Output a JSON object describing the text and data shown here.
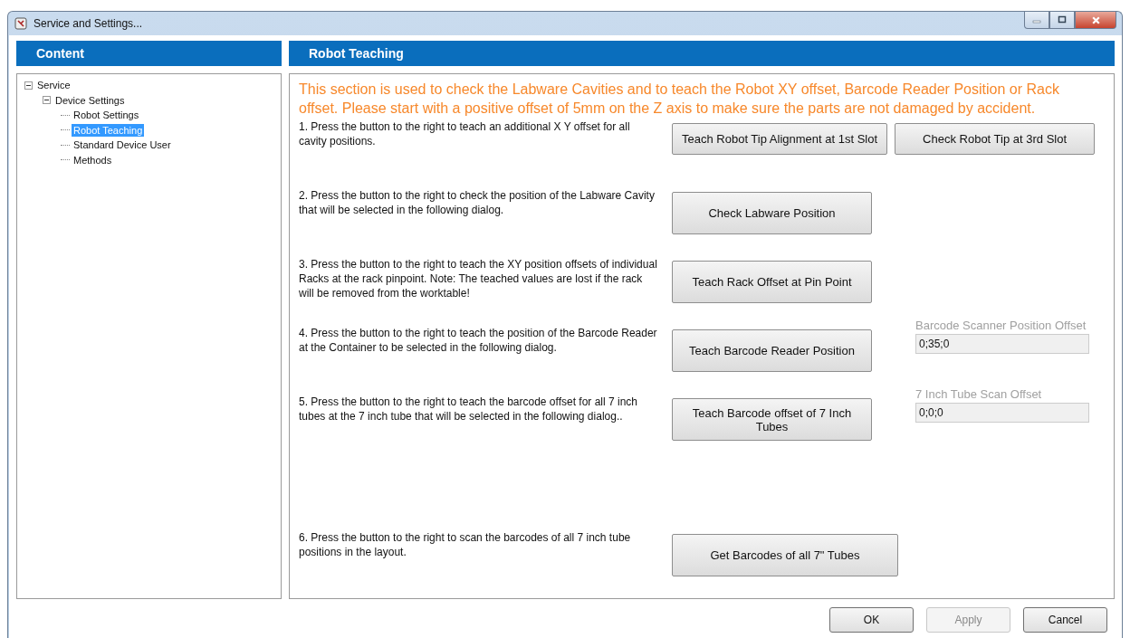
{
  "window": {
    "title": "Service and Settings..."
  },
  "sidebar": {
    "title": "Content",
    "tree": [
      {
        "label": "Service",
        "expanded": true,
        "selected": false,
        "children": [
          {
            "label": "Device Settings",
            "expanded": true,
            "selected": false,
            "children": [
              {
                "label": "Robot Settings",
                "selected": false
              },
              {
                "label": "Robot Teaching",
                "selected": true
              },
              {
                "label": "Standard Device User",
                "selected": false
              },
              {
                "label": "Methods",
                "selected": false
              }
            ]
          }
        ]
      }
    ]
  },
  "panel": {
    "title": "Robot Teaching",
    "intro": "This section is used to check the Labware Cavities and to teach the Robot XY offset, Barcode Reader Position or Rack offset. Please start with a positive offset of 5mm on the Z axis to make sure the parts are not damaged by accident.",
    "steps": [
      {
        "text": "1. Press the button to the right to teach an additional X Y offset for all cavity positions.",
        "buttons": [
          "Teach Robot Tip Alignment at 1st Slot",
          "Check Robot Tip at 3rd Slot"
        ]
      },
      {
        "text": "2. Press the button to the right to check the position of the Labware Cavity that will be selected in the following dialog.",
        "buttons": [
          "Check Labware Position"
        ]
      },
      {
        "text": "3. Press the button to the right to teach the XY position offsets of individual Racks at the rack pinpoint. Note: The teached values are lost if the rack will be removed from the worktable!",
        "buttons": [
          "Teach Rack Offset at Pin Point"
        ]
      },
      {
        "text": "4. Press the button to the right to teach the position of the Barcode Reader at the Container to be selected in the following dialog.",
        "buttons": [
          "Teach Barcode Reader Position"
        ],
        "field": {
          "label": "Barcode Scanner Position Offset",
          "value": "0;35;0",
          "disabled": true
        }
      },
      {
        "text": "5. Press the button to the right to teach the barcode offset for all 7 inch tubes at the 7 inch tube that will be selected in the following dialog..",
        "buttons": [
          "Teach Barcode offset of 7 Inch Tubes"
        ],
        "field": {
          "label": "7 Inch Tube Scan Offset",
          "value": "0;0;0",
          "disabled": true
        }
      },
      {
        "text": "6. Press the button to the right to scan the barcodes of all 7 inch tube positions in the layout.",
        "buttons": [
          "Get Barcodes of all 7\" Tubes"
        ]
      }
    ]
  },
  "buttons": [
    {
      "label": "OK",
      "disabled": false
    },
    {
      "label": "Apply",
      "disabled": true
    },
    {
      "label": "Cancel",
      "disabled": false
    }
  ]
}
